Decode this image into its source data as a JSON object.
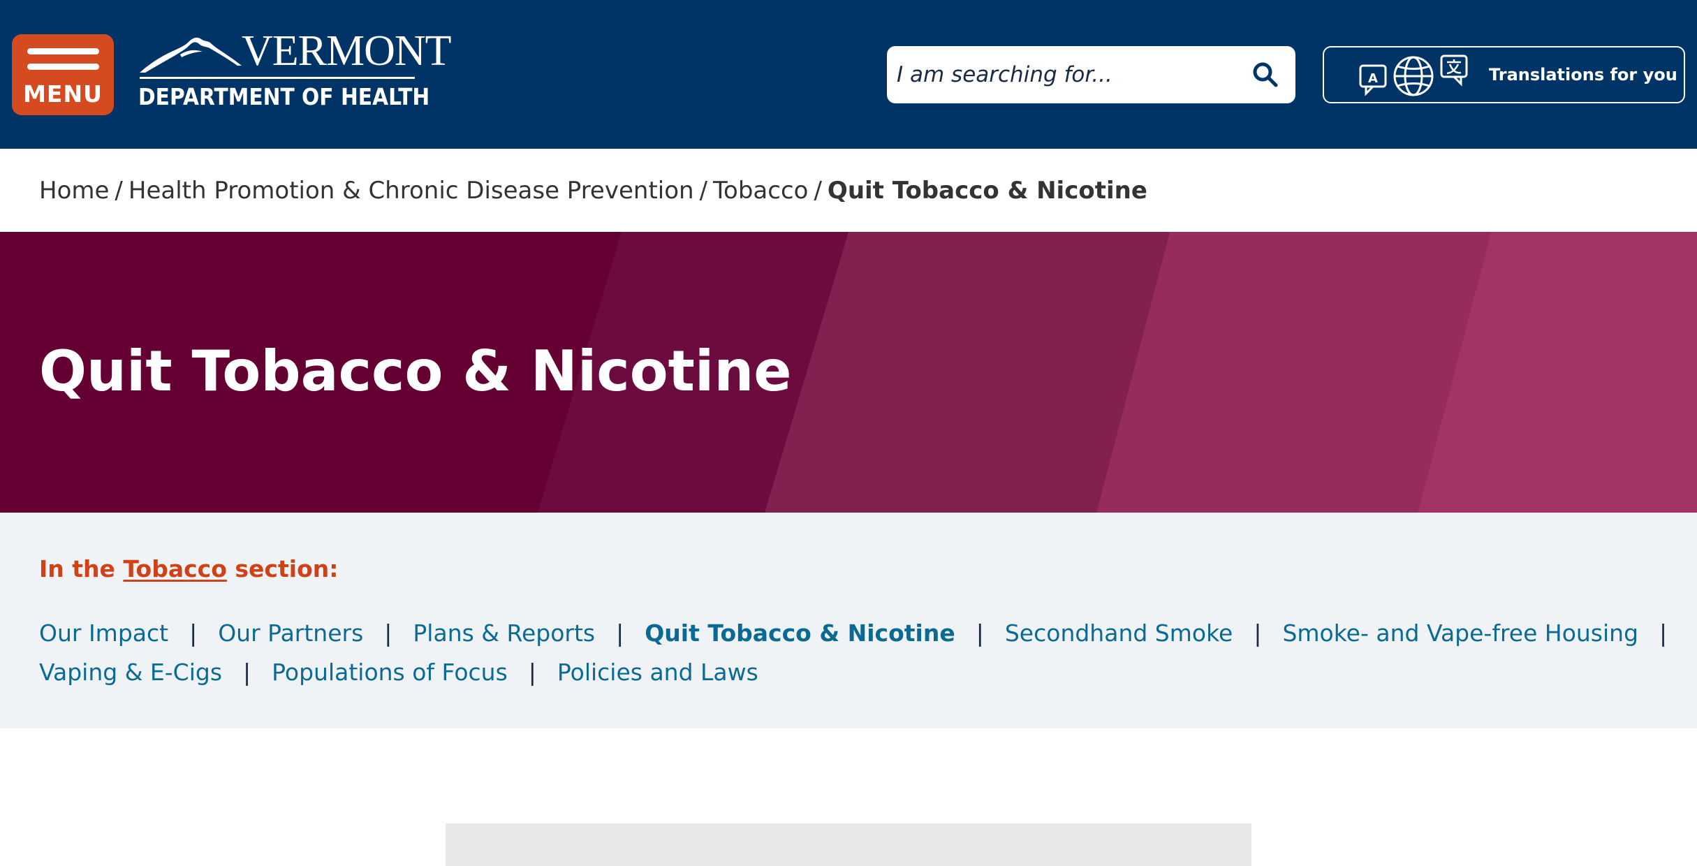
{
  "header": {
    "menu_label": "MENU",
    "logo": {
      "name": "VERMONT",
      "subtitle": "DEPARTMENT OF HEALTH"
    },
    "search": {
      "placeholder": "I am searching for..."
    },
    "translations_label": "Translations for you"
  },
  "breadcrumb": {
    "items": [
      "Home",
      "Health Promotion & Chronic Disease Prevention",
      "Tobacco"
    ],
    "separator": "/",
    "current": "Quit Tobacco & Nicotine"
  },
  "hero": {
    "title": "Quit Tobacco & Nicotine"
  },
  "section_nav": {
    "heading_prefix": "In the",
    "heading_link": "Tobacco",
    "heading_suffix": "section:",
    "separator": "|",
    "row1": [
      "Our Impact",
      "Our Partners",
      "Plans & Reports",
      "Quit Tobacco & Nicotine",
      "Secondhand Smoke",
      "Smoke- and Vape-free Housing"
    ],
    "row2": [
      "Vaping & E-Cigs",
      "Populations of Focus",
      "Policies and Laws"
    ],
    "active": "Quit Tobacco & Nicotine"
  },
  "colors": {
    "header_bg": "#003366",
    "menu_bg": "#d64a1f",
    "hero_bg": "#650033",
    "section_bg": "#eff3f6",
    "link": "#0b6a94",
    "accent": "#d14117"
  }
}
